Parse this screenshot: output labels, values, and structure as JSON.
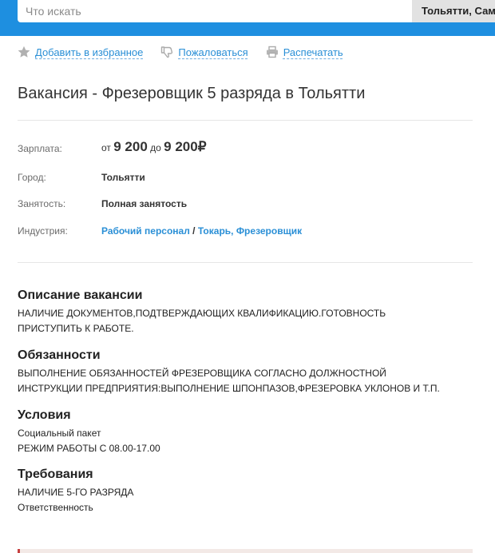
{
  "search": {
    "placeholder": "Что искать",
    "city": "Тольятти, Сам"
  },
  "actions": {
    "favorite": "Добавить в избранное",
    "complain": "Пожаловаться",
    "print": "Распечатать"
  },
  "title": "Вакансия - Фрезеровщик 5 разряда в Тольятти",
  "info": {
    "salary_label": "Зарплата:",
    "salary_from_prefix": "от",
    "salary_from": "9 200",
    "salary_to_prefix": "до",
    "salary_to": "9 200",
    "currency": "₽",
    "city_label": "Город:",
    "city": "Тольятти",
    "employment_label": "Занятость:",
    "employment": "Полная занятость",
    "industry_label": "Индустрия:",
    "industry_main": "Рабочий персонал",
    "industry_separator": "/",
    "industry_sub": "Токарь, Фрезеровщик"
  },
  "sections": {
    "description_title": "Описание вакансии",
    "description_line1": "НАЛИЧИЕ ДОКУМЕНТОВ,ПОДТВЕРЖДАЮЩИХ КВАЛИФИКАЦИЮ.ГОТОВНОСТЬ",
    "description_line2": "ПРИСТУПИТЬ К РАБОТЕ.",
    "duties_title": "Обязанности",
    "duties_line1": "ВЫПОЛНЕНИЕ ОБЯЗАННОСТЕЙ ФРЕЗЕРОВЩИКА СОГЛАСНО ДОЛЖНОСТНОЙ",
    "duties_line2": "ИНСТРУКЦИИ ПРЕДПРИЯТИЯ:ВЫПОЛНЕНИЕ ШПОНПАЗОВ,ФРЕЗЕРОВКА УКЛОНОВ И Т.П.",
    "conditions_title": "Условия",
    "conditions_line1": "Социальный пакет",
    "conditions_line2": "РЕЖИМ РАБОТЫ С 08.00-17.00",
    "requirements_title": "Требования",
    "requirements_line1": "НАЛИЧИЕ 5-ГО РАЗРЯДА",
    "requirements_line2": "Ответственность"
  },
  "colors": {
    "accent": "#1e8fe0",
    "link": "#2a8fd6"
  },
  "icons": {
    "favorite": "star-icon",
    "complain": "thumb-down-icon",
    "print": "printer-icon"
  }
}
